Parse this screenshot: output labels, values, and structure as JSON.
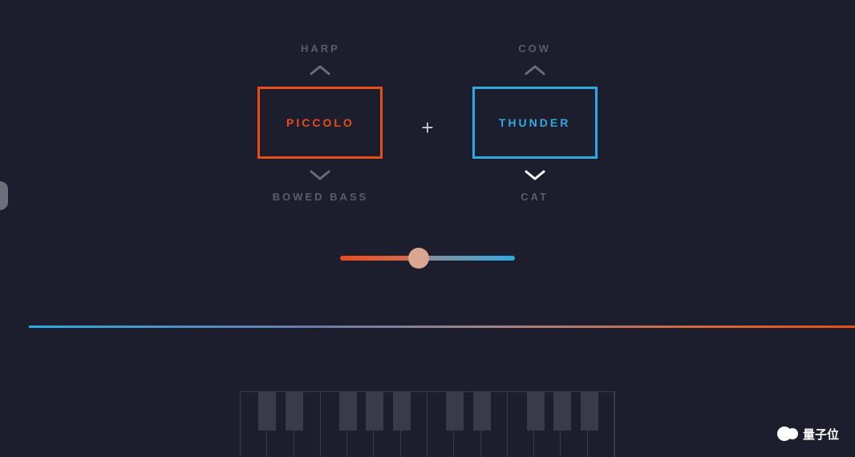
{
  "selector_left": {
    "prev_label": "HARP",
    "current": "PICCOLO",
    "next_label": "BOWED BASS",
    "color": "#e84d18"
  },
  "selector_right": {
    "prev_label": "COW",
    "current": "THUNDER",
    "next_label": "CAT",
    "color": "#2faae0"
  },
  "combine_symbol": "+",
  "blend": {
    "value_percent": 45
  },
  "keyboard": {
    "white_key_count": 14,
    "black_keys_after_white_index": [
      0,
      1,
      3,
      4,
      5,
      7,
      8,
      10,
      11,
      12
    ]
  },
  "watermark": {
    "text": "量子位"
  }
}
